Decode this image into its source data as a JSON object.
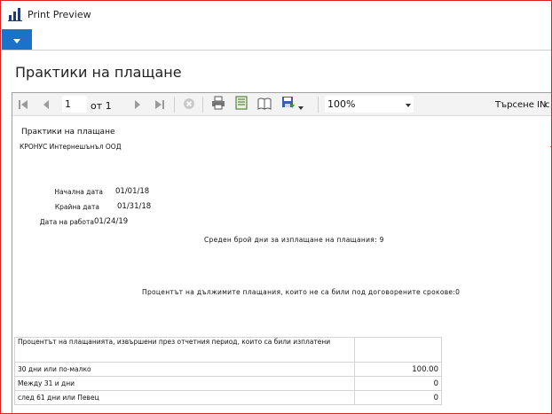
{
  "window": {
    "title": "Print Preview",
    "accent": "#1a73c9"
  },
  "page": {
    "heading": "Практики на плащане"
  },
  "toolbar": {
    "page_value": "1",
    "of_label": "от 1",
    "zoom_value": "100%",
    "search_label": "Търсене IN",
    "search_extra": "с"
  },
  "report": {
    "title": "Практики на плащане",
    "company": "КРОНУС Интернешънъл ООД",
    "start_label": "Начална дата",
    "start_value": "01/01/18",
    "end_label": "Крайна дата",
    "end_value": "01/31/18",
    "run_label": "Дата на работа",
    "run_value": "01/24/19",
    "avg_days": "Среден брой дни за изплащане на плащания: 9",
    "pct_overdue": "Процентът на дължимите плащания, които не са били под договорените срокове:0",
    "table": {
      "header": "Процентът на плащанията, извършени през отчетния период, които са били изплатени",
      "rows": [
        {
          "label": "30 дни или по-малко",
          "value": "100.00"
        },
        {
          "label": "Между 31 и дни",
          "value": "0"
        },
        {
          "label": "след 61 дни или Певец",
          "value": "0"
        }
      ]
    }
  }
}
